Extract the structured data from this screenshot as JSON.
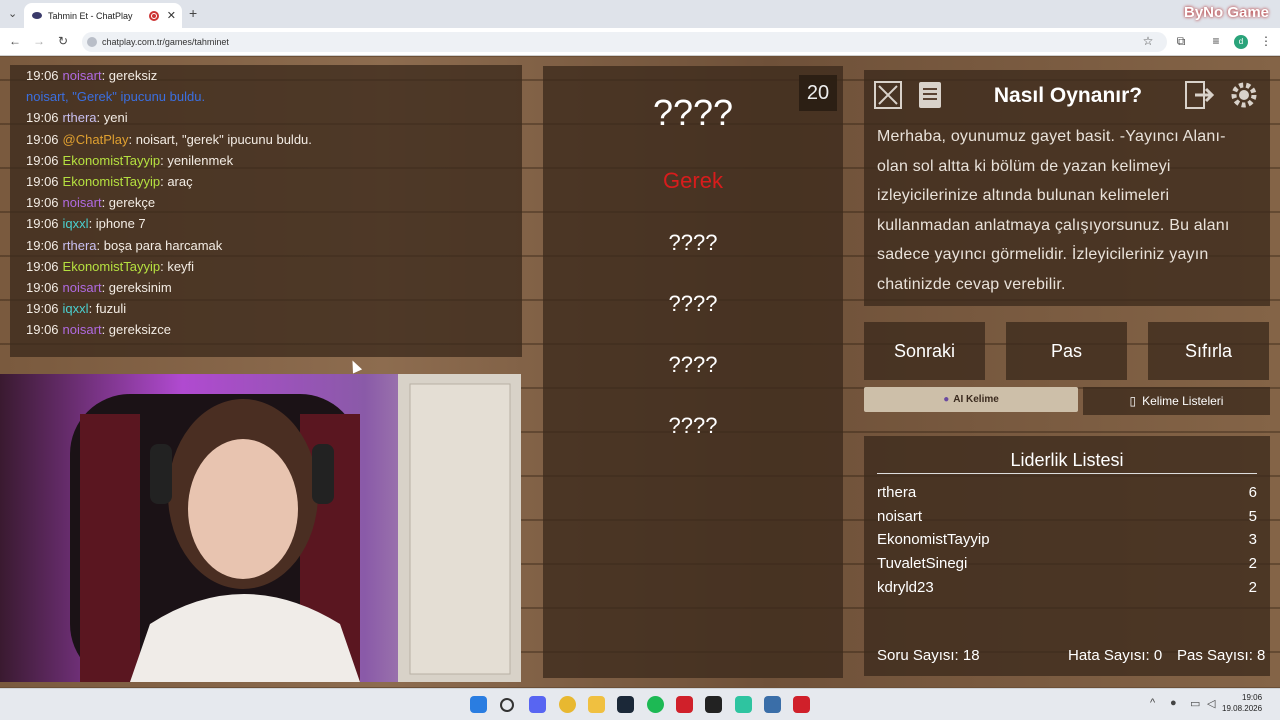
{
  "browser": {
    "tab_title": "Tahmin Et - ChatPlay",
    "tab_close": "✕",
    "new_tab": "+",
    "url": "chatplay.com.tr/games/tahminet",
    "brand": "ByNo Game",
    "profile_initial": "d"
  },
  "chat": {
    "messages": [
      {
        "time": "19:06",
        "user": "noisart",
        "text": ": gereksiz",
        "user_color": "#b06ae0"
      },
      {
        "time": "",
        "user": "noisart, \"Gerek\" ipucunu buldu.",
        "text": "",
        "user_color": "#3b6fe0"
      },
      {
        "time": "19:06",
        "user": "rthera",
        "text": ": yeni",
        "user_color": "#c9c0f0"
      },
      {
        "time": "19:06",
        "user": "@ChatPlay",
        "text": ": noisart, \"gerek\" ipucunu buldu.",
        "user_color": "#e0a030"
      },
      {
        "time": "19:06",
        "user": "EkonomistTayyip",
        "text": ": yenilenmek",
        "user_color": "#b5e040"
      },
      {
        "time": "19:06",
        "user": "EkonomistTayyip",
        "text": ": araç",
        "user_color": "#b5e040"
      },
      {
        "time": "19:06",
        "user": "noisart",
        "text": ": gerekçe",
        "user_color": "#b06ae0"
      },
      {
        "time": "19:06",
        "user": "iqxxl",
        "text": ": iphone 7",
        "user_color": "#4ad0d0"
      },
      {
        "time": "19:06",
        "user": "rthera",
        "text": ": boşa para harcamak",
        "user_color": "#c9c0f0"
      },
      {
        "time": "19:06",
        "user": "EkonomistTayyip",
        "text": ": keyfi",
        "user_color": "#b5e040"
      },
      {
        "time": "19:06",
        "user": "noisart",
        "text": ": gereksinim",
        "user_color": "#b06ae0"
      },
      {
        "time": "19:06",
        "user": "iqxxl",
        "text": ": fuzuli",
        "user_color": "#4ad0d0"
      },
      {
        "time": "19:06",
        "user": "noisart",
        "text": ": gereksizce",
        "user_color": "#b06ae0"
      }
    ]
  },
  "game": {
    "counter": "20",
    "main_word": "????",
    "hints": [
      {
        "text": "Gerek",
        "color": "#d81c1c"
      },
      {
        "text": "????",
        "color": "#ffffff"
      },
      {
        "text": "????",
        "color": "#ffffff"
      },
      {
        "text": "????",
        "color": "#ffffff"
      },
      {
        "text": "????",
        "color": "#ffffff"
      }
    ]
  },
  "howto": {
    "title": "Nasıl Oynanır?",
    "text": "Merhaba, oyunumuz gayet basit. -Yayıncı Alanı- olan sol altta ki bölüm de yazan kelimeyi izleyicilerinize altında bulunan kelimeleri kullanmadan anlatmaya çalışıyorsunuz. Bu alanı sadece yayıncı görmelidir. İzleyicileriniz yayın chatinizde cevap verebilir."
  },
  "controls": {
    "next": "Sonraki",
    "pass": "Pas",
    "reset": "Sıfırla",
    "ai_word": "AI Kelime",
    "word_lists": "Kelime Listeleri"
  },
  "leaderboard": {
    "title": "Liderlik Listesi",
    "entries": [
      {
        "name": "rthera",
        "score": "6"
      },
      {
        "name": "noisart",
        "score": "5"
      },
      {
        "name": "EkonomistTayyip",
        "score": "3"
      },
      {
        "name": "TuvaletSinegi",
        "score": "2"
      },
      {
        "name": "kdryld23",
        "score": "2"
      }
    ],
    "questions": "Soru Sayısı: 18",
    "errors": "Hata Sayısı: 0",
    "passes": "Pas Sayısı: 8"
  },
  "taskbar": {
    "time": "19:06",
    "date": "19.08.2026"
  }
}
